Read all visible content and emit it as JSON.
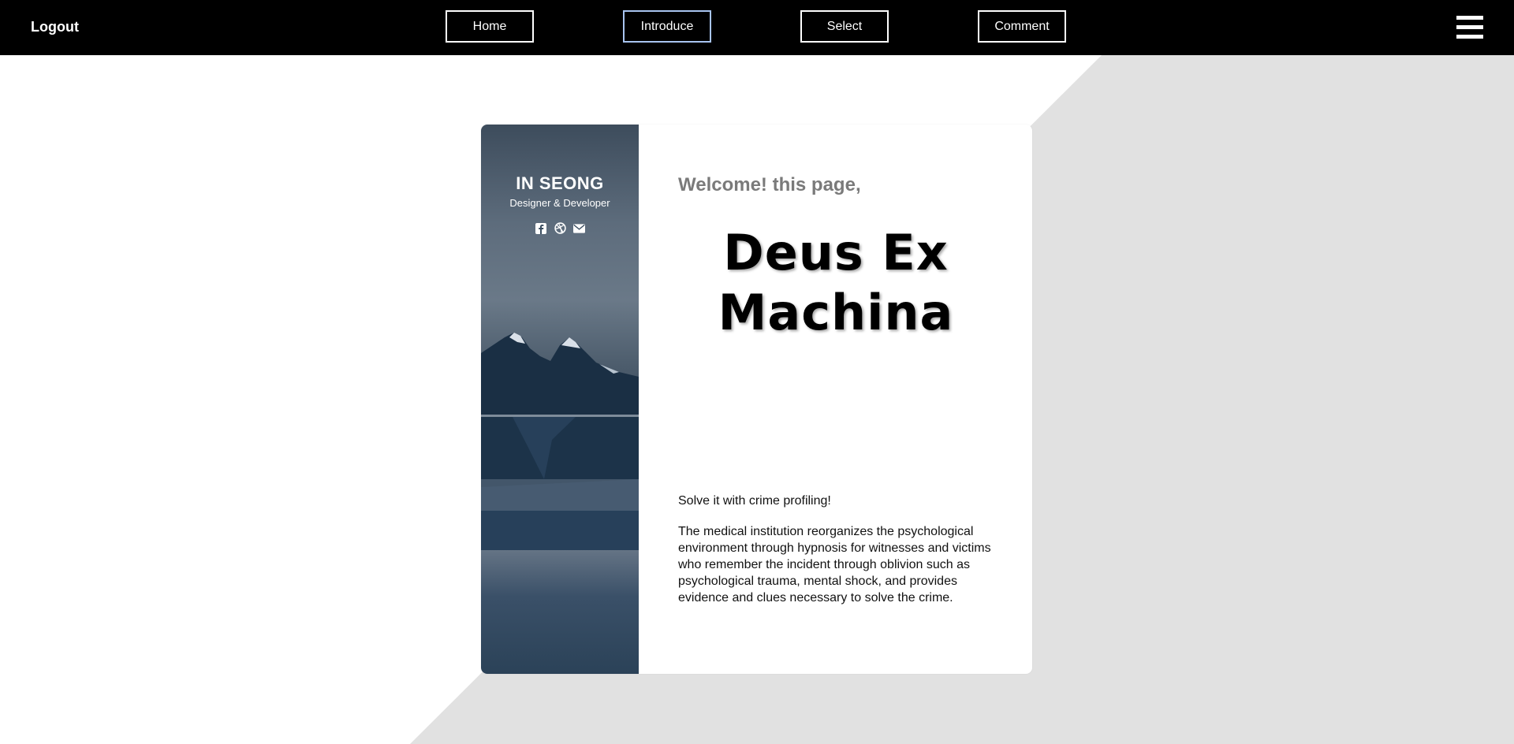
{
  "nav": {
    "logout": "Logout",
    "items": [
      {
        "label": "Home"
      },
      {
        "label": "Introduce"
      },
      {
        "label": "Select"
      },
      {
        "label": "Comment"
      }
    ],
    "active": "Introduce"
  },
  "profile": {
    "name": "IN SEONG",
    "role": "Designer & Developer",
    "icons": [
      "facebook-icon",
      "dribbble-icon",
      "email-icon"
    ]
  },
  "content": {
    "welcome": "Welcome! this page,",
    "title_line1": "Deus Ex",
    "title_line2": "Machina",
    "tagline": "Solve it with crime profiling!",
    "description": "The medical institution reorganizes the psychological environment through hypnosis for witnesses and victims who remember the incident through oblivion such as psychological trauma, mental shock, and provides evidence and clues necessary to solve the crime."
  },
  "colors": {
    "navbar": "#000000",
    "background_diagonal": "#e1e1e1",
    "active_border": "#a8c4f0"
  }
}
